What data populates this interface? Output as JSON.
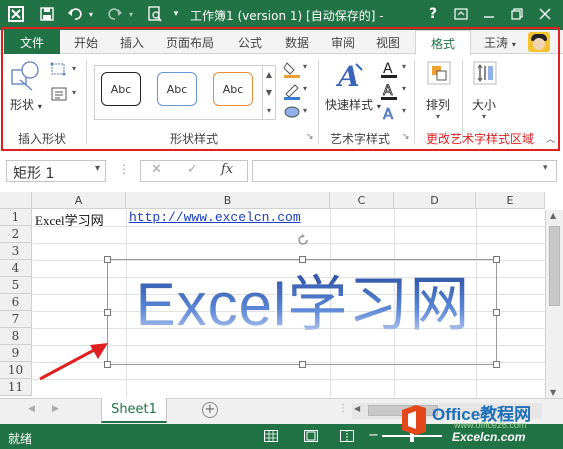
{
  "titlebar": {
    "title": "工作簿1 (version 1) [自动保存的] -",
    "help": "?",
    "icons": [
      "excel-icon",
      "save-icon",
      "undo-icon",
      "redo-icon",
      "print-preview-icon",
      "customize-icon"
    ],
    "window_controls": [
      "ribbon-display-icon",
      "minimize-icon",
      "restore-icon",
      "close-icon"
    ]
  },
  "ribbon": {
    "tabs": [
      "文件",
      "开始",
      "插入",
      "页面布局",
      "公式",
      "数据",
      "审阅",
      "视图",
      "格式"
    ],
    "active_tab": "格式",
    "user": "王涛",
    "groups": {
      "insert_shapes": {
        "label": "插入形状",
        "shape_label": "形状"
      },
      "shape_styles": {
        "label": "形状样式",
        "samples": [
          "Abc",
          "Abc",
          "Abc"
        ]
      },
      "wordart_styles": {
        "label": "艺术字样式",
        "quick_styles": "快速样式"
      },
      "arrange": {
        "label": "排列"
      },
      "size": {
        "label": "大小"
      }
    },
    "annotation": "更改艺术字样式区域"
  },
  "formula_bar": {
    "name_box": "矩形 1",
    "cancel": "✕",
    "enter": "✓",
    "fx": "fx",
    "value": ""
  },
  "grid": {
    "columns": [
      "A",
      "B",
      "C",
      "D",
      "E"
    ],
    "rows": [
      "1",
      "2",
      "3",
      "4",
      "5",
      "6",
      "7",
      "8",
      "9",
      "10",
      "11"
    ],
    "cells": {
      "A1": "Excel学习网",
      "B1": "http://www.excelcn.com"
    },
    "wordart_text": "Excel学习网"
  },
  "sheets": {
    "tabs": [
      "Sheet1"
    ],
    "add": "+"
  },
  "status": {
    "text": "就绪",
    "watermark1": "Office教程网",
    "watermark2": "www.office26.com",
    "watermark3": "Excelcn.com"
  },
  "colors": {
    "accent": "#217346",
    "annotation": "#e02020",
    "wordart": "#3a64b8"
  }
}
